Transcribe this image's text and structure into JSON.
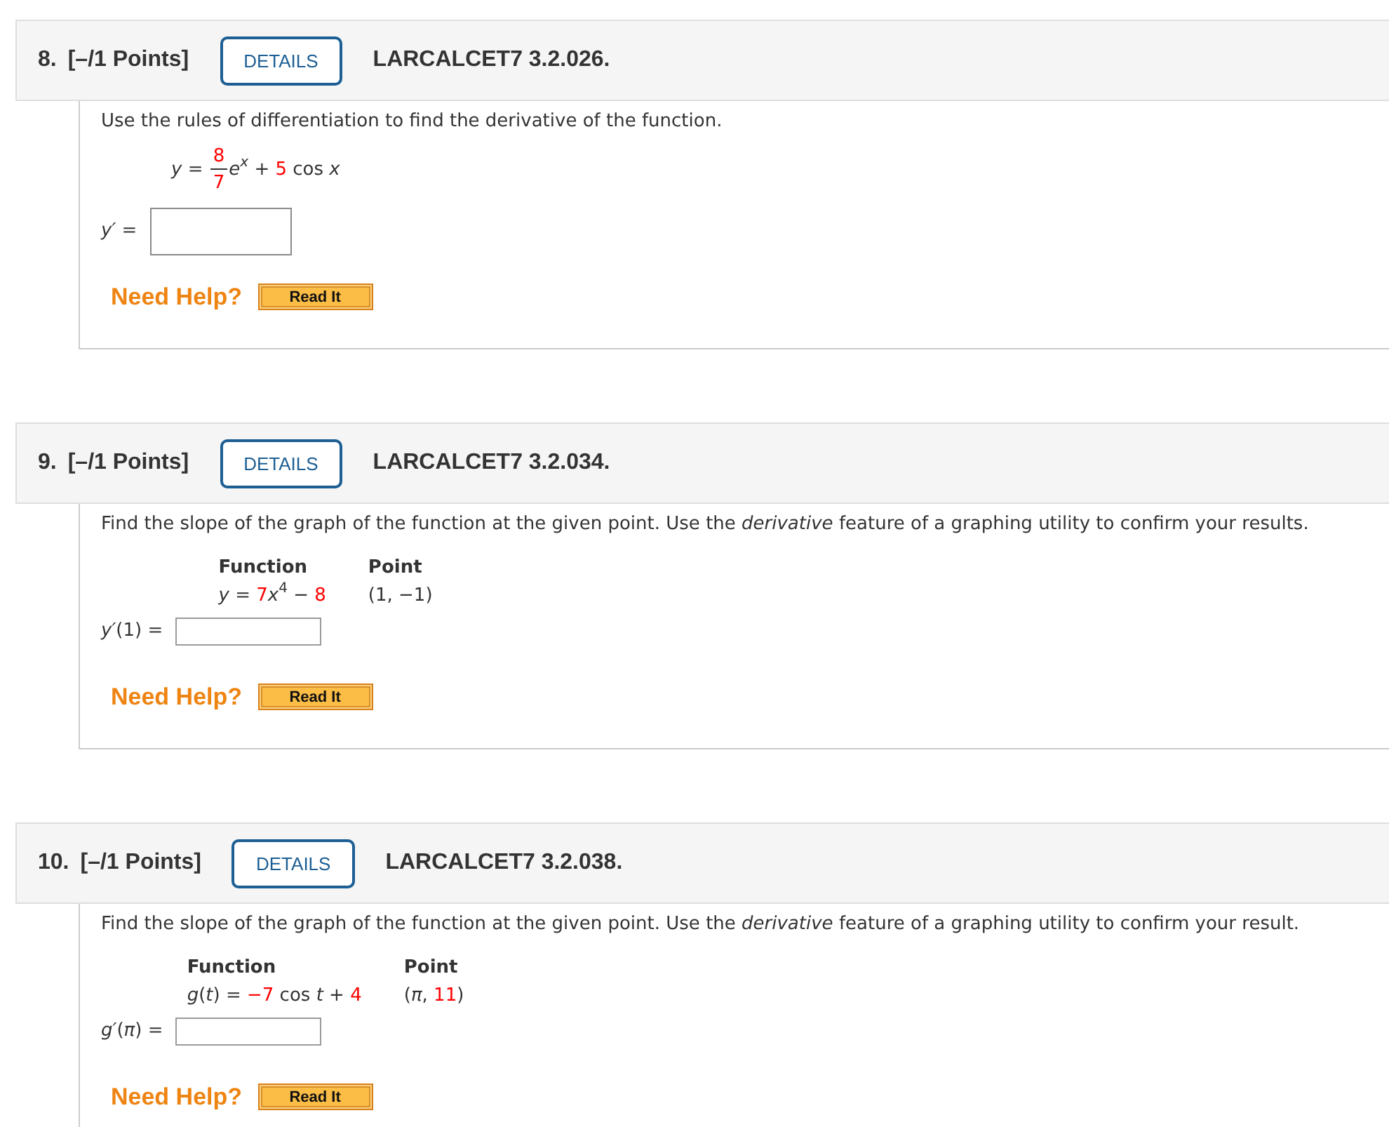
{
  "questions": [
    {
      "number": "8.",
      "points": "[–/1 Points]",
      "details": "DETAILS",
      "code": "LARCALCET7 3.2.026.",
      "kind": "equation",
      "prompt": "Use the rules of differentiation to find the derivative of the function.",
      "equation": [
        {
          "kind": "var",
          "text": "y"
        },
        {
          "kind": "text",
          "text": " = "
        },
        {
          "kind": "frac",
          "num": "8",
          "den": "7"
        },
        {
          "kind": "var",
          "text": "e"
        },
        {
          "kind": "supvar",
          "text": "x"
        },
        {
          "kind": "text",
          "text": " + "
        },
        {
          "kind": "num",
          "text": "5"
        },
        {
          "kind": "text",
          "text": " cos "
        },
        {
          "kind": "var",
          "text": "x"
        }
      ],
      "answer_label": [
        {
          "kind": "var",
          "text": "y′"
        },
        {
          "kind": "text",
          "text": " = "
        }
      ],
      "help": "Need Help?",
      "button": "Read It"
    },
    {
      "number": "9.",
      "points": "[–/1 Points]",
      "details": "DETAILS",
      "code": "LARCALCET7 3.2.034.",
      "kind": "table",
      "prompt": "Find the slope of the graph of the function at the given point. Use the *derivative* feature of a graphing utility to confirm your results.",
      "columns": [
        {
          "heading": "Function",
          "math": [
            {
              "kind": "var",
              "text": "y"
            },
            {
              "kind": "text",
              "text": " = "
            },
            {
              "kind": "num",
              "text": "7"
            },
            {
              "kind": "var",
              "text": "x"
            },
            {
              "kind": "sup",
              "text": "4"
            },
            {
              "kind": "text",
              "text": " − "
            },
            {
              "kind": "num",
              "text": "8"
            }
          ]
        },
        {
          "heading": "Point",
          "math": [
            {
              "kind": "text",
              "text": "(1, −1)"
            }
          ]
        }
      ],
      "answer_label": [
        {
          "kind": "var",
          "text": "y′"
        },
        {
          "kind": "text",
          "text": "(1) = "
        }
      ],
      "help": "Need Help?",
      "button": "Read It"
    },
    {
      "number": "10.",
      "points": "[–/1 Points]",
      "details": "DETAILS",
      "code": "LARCALCET7 3.2.038.",
      "kind": "table",
      "prompt": "Find the slope of the graph of the function at the given point. Use the *derivative* feature of a graphing utility to confirm your result.",
      "columns": [
        {
          "heading": "Function",
          "math": [
            {
              "kind": "var",
              "text": "g"
            },
            {
              "kind": "text",
              "text": "("
            },
            {
              "kind": "var",
              "text": "t"
            },
            {
              "kind": "text",
              "text": ") = "
            },
            {
              "kind": "num",
              "text": "−7"
            },
            {
              "kind": "text",
              "text": " cos "
            },
            {
              "kind": "var",
              "text": "t"
            },
            {
              "kind": "text",
              "text": " + "
            },
            {
              "kind": "num",
              "text": "4"
            }
          ]
        },
        {
          "heading": "Point",
          "math": [
            {
              "kind": "text",
              "text": "("
            },
            {
              "kind": "var",
              "text": "π"
            },
            {
              "kind": "text",
              "text": ", "
            },
            {
              "kind": "num",
              "text": "11"
            },
            {
              "kind": "text",
              "text": ")"
            }
          ]
        }
      ],
      "answer_label": [
        {
          "kind": "var",
          "text": "g′"
        },
        {
          "kind": "text",
          "text": "("
        },
        {
          "kind": "var",
          "text": "π"
        },
        {
          "kind": "text",
          "text": ") = "
        }
      ],
      "help": "Need Help?",
      "button": "Read It"
    }
  ]
}
